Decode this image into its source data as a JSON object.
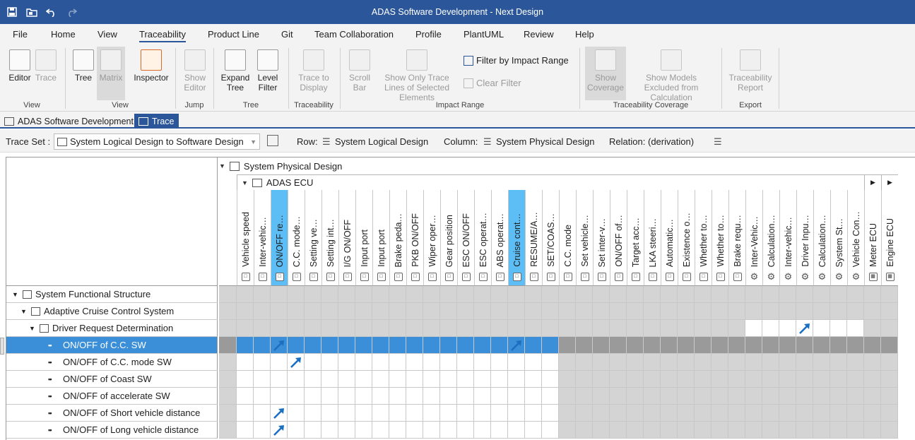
{
  "window": {
    "title": "ADAS Software Development - Next Design"
  },
  "menu": [
    "File",
    "Home",
    "View",
    "Traceability",
    "Product Line",
    "Git",
    "Team Collaboration",
    "Profile",
    "PlantUML",
    "Review",
    "Help"
  ],
  "ribbon": {
    "editor": "Editor",
    "trace": "Trace",
    "group_view": "View",
    "tree": "Tree",
    "matrix": "Matrix",
    "inspector": "Inspector",
    "group_view2": "View",
    "show_editor": "Show Editor",
    "group_jump": "Jump",
    "expand_tree": "Expand Tree",
    "level_filter": "Level Filter",
    "group_tree": "Tree",
    "trace_to_display": "Trace to Display",
    "group_traceability": "Traceability",
    "scroll_bar": "Scroll Bar",
    "show_only": "Show Only Trace Lines of Selected Elements",
    "filter_by_impact": "Filter by Impact Range",
    "clear_filter": "Clear Filter",
    "group_impact": "Impact Range",
    "show_coverage": "Show Coverage",
    "show_models_excluded": "Show Models Excluded from Calculation",
    "group_coverage": "Traceability Coverage",
    "traceability_report": "Traceability Report",
    "group_export": "Export"
  },
  "doc_tabs": [
    {
      "label": "ADAS Software Development"
    },
    {
      "label": "Trace"
    }
  ],
  "toolbar": {
    "trace_set_label": "Trace Set :",
    "trace_set_value": "System Logical Design to Software Design",
    "row_label": "Row:",
    "row_value": "System Logical Design",
    "column_label": "Column:",
    "column_value": "System Physical Design",
    "relation_label": "Relation:",
    "relation_value": "(derivation)"
  },
  "matrix": {
    "column_root": "System Physical Design",
    "column_group": "ADAS ECU",
    "columns": [
      "Vehicle speed",
      "Inter-vehic…",
      "ON/OFF re…",
      "C.C. mode…",
      "Setting ve…",
      "Setting int…",
      "I/G ON/OFF",
      "Input port",
      "Input port",
      "Brake peda…",
      "PKB ON/OFF",
      "Wiper oper…",
      "Gear position",
      "ESC ON/OFF",
      "ESC operat…",
      "ABS operat…",
      "Cruise cont…",
      "RESUME/A…",
      "SET/COAS…",
      "C.C. mode",
      "Set vehicle…",
      "Set inter-v…",
      "ON/OFF of…",
      "Target acc…",
      "LKA steeri…",
      "Automatic…",
      "Existence o…",
      "Whether to…",
      "Whether to…",
      "Brake requ…",
      "Inter-Vehic…",
      "Calculation…",
      "Inter-vehic…",
      "Driver Inpu…",
      "Calculation…",
      "System St…",
      "Vehicle Con…",
      "Meter ECU",
      "Engine ECU"
    ],
    "rows": [
      {
        "label": "System Functional Structure",
        "level": 0
      },
      {
        "label": "Adaptive Cruise Control System",
        "level": 1
      },
      {
        "label": "Driver Request Determination",
        "level": 2
      },
      {
        "label": "ON/OFF of C.C. SW",
        "level": 3
      },
      {
        "label": "ON/OFF of C.C. mode SW",
        "level": 3
      },
      {
        "label": "ON/OFF of Coast SW",
        "level": 3
      },
      {
        "label": "ON/OFF of  accelerate SW",
        "level": 3
      },
      {
        "label": "ON/OFF of Short vehicle distance",
        "level": 3
      },
      {
        "label": "ON/OFF of Long vehicle distance",
        "level": 3
      }
    ],
    "trace_links": [
      {
        "row": 2,
        "col": 33
      },
      {
        "row": 3,
        "col": 2
      },
      {
        "row": 3,
        "col": 16
      },
      {
        "row": 4,
        "col": 3
      },
      {
        "row": 7,
        "col": 2
      },
      {
        "row": 8,
        "col": 2
      }
    ],
    "highlighted_columns": [
      2,
      16
    ],
    "selected_row": 3
  },
  "colors": {
    "accent": "#2b579a",
    "selection": "#3a8fd8",
    "highlight_col": "#5cbef5",
    "arrow": "#1a6fc0"
  }
}
